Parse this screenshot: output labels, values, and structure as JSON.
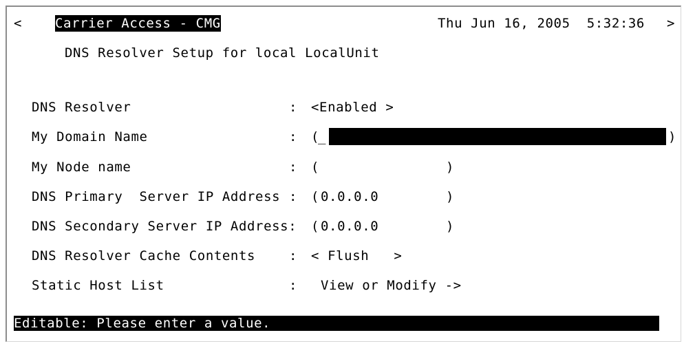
{
  "header": {
    "nav_left": "<",
    "app_title": "Carrier Access - CMG",
    "datetime": "Thu Jun 16, 2005  5:32:36",
    "nav_right": ">"
  },
  "page_title": "DNS Resolver Setup for local LocalUnit",
  "fields": [
    {
      "label": "DNS Resolver",
      "sep": ":",
      "value": "<Enabled >"
    },
    {
      "label": "My Domain Name",
      "sep": ":",
      "open": "(",
      "cursor": "_",
      "close": ")"
    },
    {
      "label": "My Node name",
      "sep": ":",
      "open": "(",
      "close": ")"
    },
    {
      "label": "DNS Primary  Server IP Address",
      "sep": ":",
      "open": "(",
      "value": "0.0.0.0",
      "close": ")"
    },
    {
      "label": "DNS Secondary Server IP Address:",
      "open": "(",
      "value": "0.0.0.0",
      "close": ")"
    },
    {
      "label": "DNS Resolver Cache Contents",
      "sep": ":",
      "value": "< Flush   >"
    },
    {
      "label": "Static Host List",
      "sep": ":",
      "value": "View or Modify ->"
    }
  ],
  "status_bar": "Editable: Please enter a value."
}
